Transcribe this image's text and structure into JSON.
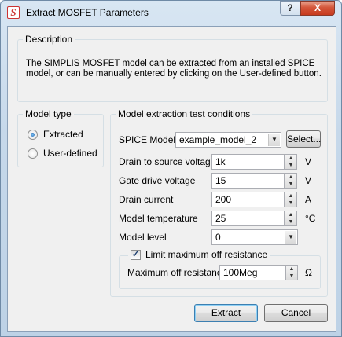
{
  "window": {
    "title": "Extract MOSFET Parameters",
    "help_label": "?",
    "close_label": "X"
  },
  "description": {
    "group_title": "Description",
    "text": "The SIMPLIS MOSFET model can be extracted from an installed SPICE model, or can be manually entered by clicking on the User-defined button."
  },
  "model_type": {
    "group_title": "Model type",
    "options": [
      {
        "label": "Extracted",
        "selected": true
      },
      {
        "label": "User-defined",
        "selected": false
      }
    ]
  },
  "conditions": {
    "group_title": "Model extraction test conditions",
    "spice_model": {
      "label": "SPICE Model",
      "value": "example_model_2",
      "select_label": "Select..."
    },
    "drain_source_voltage": {
      "label": "Drain to source voltage",
      "value": "1k",
      "unit": "V"
    },
    "gate_drive_voltage": {
      "label": "Gate drive voltage",
      "value": "15",
      "unit": "V"
    },
    "drain_current": {
      "label": "Drain current",
      "value": "200",
      "unit": "A"
    },
    "model_temperature": {
      "label": "Model temperature",
      "value": "25",
      "unit": "°C"
    },
    "model_level": {
      "label": "Model level",
      "value": "0"
    },
    "limit_off_resistance": {
      "label": "Limit maximum off resistance",
      "checked": true,
      "max_label": "Maximum off resistance",
      "max_value": "100Meg",
      "unit": "Ω"
    }
  },
  "buttons": {
    "extract": "Extract",
    "cancel": "Cancel"
  }
}
